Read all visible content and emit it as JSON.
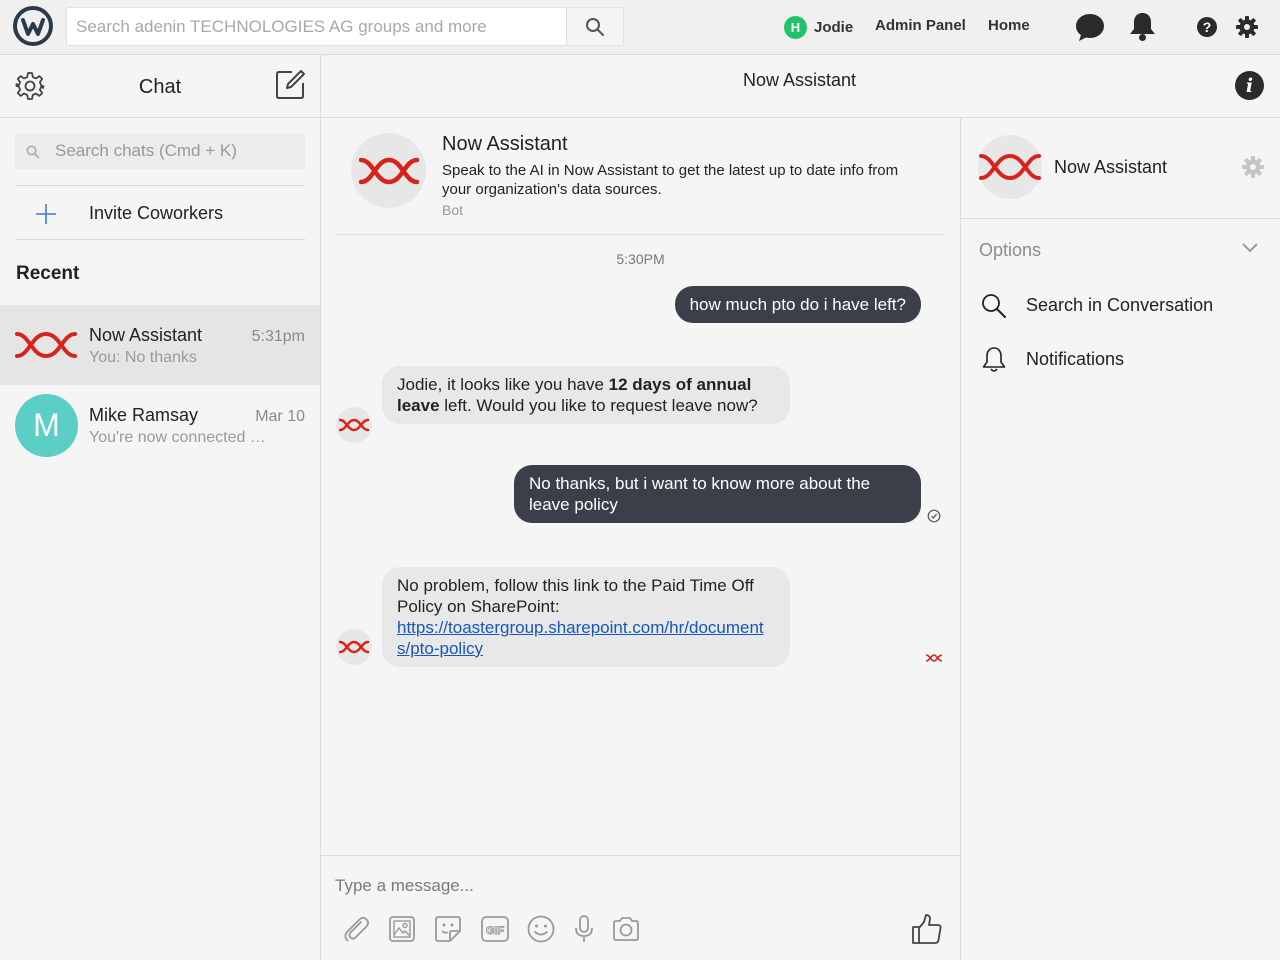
{
  "topbar": {
    "logo_icon": "workplace-logo-icon",
    "search_placeholder": "Search adenin TECHNOLOGIES AG groups and more",
    "user_initial": "H",
    "user_name": "Jodie",
    "admin_panel": "Admin Panel",
    "home": "Home",
    "icons": [
      "chat-bubble-icon",
      "bell-icon",
      "help-icon",
      "gear-icon"
    ]
  },
  "sidebar": {
    "title": "Chat",
    "search_placeholder": "Search chats (Cmd + K)",
    "invite_label": "Invite Coworkers",
    "recent_label": "Recent",
    "conversations": [
      {
        "name": "Now Assistant",
        "time": "5:31pm",
        "preview": "You: No thanks",
        "avatar": "now-assistant-logo"
      },
      {
        "name": "Mike Ramsay",
        "time": "Mar 10",
        "preview": "You're now connected …",
        "avatar_letter": "M"
      }
    ]
  },
  "conversation": {
    "header_title": "Now Assistant",
    "bot": {
      "name": "Now Assistant",
      "description": "Speak to the AI in Now Assistant to get the latest up to date info from your organization's data sources.",
      "tag": "Bot"
    },
    "timestamp": "5:30PM",
    "messages": [
      {
        "from": "me",
        "text": "how much pto do i have left?"
      },
      {
        "from": "bot",
        "pre": "Jodie, it looks like you have ",
        "bold": "12 days of annual leave",
        "post": " left. Would you like to request leave now?"
      },
      {
        "from": "me",
        "text": "No thanks, but i want to know more about the leave policy"
      },
      {
        "from": "bot",
        "text": "No problem, follow this link to the Paid Time Off Policy on SharePoint:",
        "link": "https://toastergroup.sharepoint.com/hr/documents/pto-policy"
      }
    ],
    "composer_placeholder": "Type a message..."
  },
  "details": {
    "name": "Now Assistant",
    "options_label": "Options",
    "options": [
      {
        "label": "Search in Conversation",
        "icon": "search-icon"
      },
      {
        "label": "Notifications",
        "icon": "bell-icon"
      }
    ]
  },
  "colors": {
    "bubble_out": "#3a3f4a",
    "bubble_in": "#e8e8e8",
    "brand_red": "#d8231a",
    "link": "#1757b8",
    "avatar_teal": "#5bcfc6",
    "presence_green": "#1ec467"
  }
}
